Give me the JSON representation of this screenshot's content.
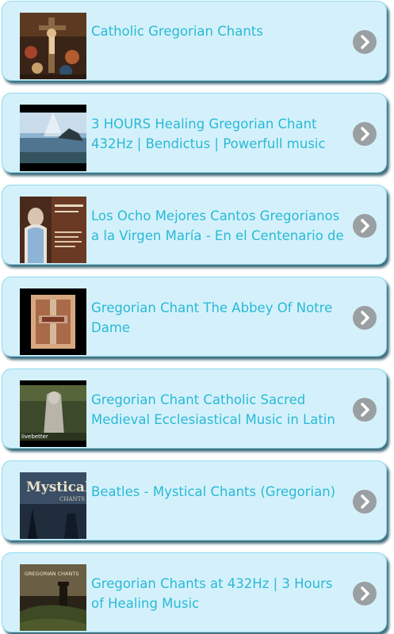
{
  "items": [
    {
      "title": "Catholic Gregorian Chants",
      "thumbnail": "renaissance-crucifixion-painting",
      "action_icon": "chevron-right-icon"
    },
    {
      "title": "3 HOURS Healing Gregorian Chant 432Hz | Bendictus | Powerfull music for healing",
      "thumbnail": "sun-rays-over-sea",
      "action_icon": "chevron-right-icon"
    },
    {
      "title": "Los Ocho Mejores Cantos Gregorianos a la Virgen María - En el Centenario de",
      "thumbnail": "virgin-mary-statue",
      "action_icon": "chevron-right-icon"
    },
    {
      "title": "Gregorian Chant The Abbey Of Notre Dame",
      "thumbnail": "abbey-album-cover",
      "action_icon": "chevron-right-icon"
    },
    {
      "title": "Gregorian Chant Catholic Sacred Medieval Ecclesiastical Music in Latin",
      "thumbnail": "monk-statue-forest",
      "action_icon": "chevron-right-icon"
    },
    {
      "title": "Beatles - Mystical Chants (Gregorian)",
      "thumbnail": "mystical-chants-cover",
      "action_icon": "chevron-right-icon"
    },
    {
      "title": "Gregorian Chants at 432Hz | 3 Hours of Healing Music",
      "thumbnail": "castle-landscape",
      "action_icon": "chevron-right-icon"
    }
  ],
  "thumb_labels": {
    "item3_text": "Ocho Cantos",
    "item5_text": "livebetter",
    "item6_text": "Mystical",
    "item6_sub": "CHANTS",
    "item7_text": "GREGORIAN CHANTS"
  }
}
